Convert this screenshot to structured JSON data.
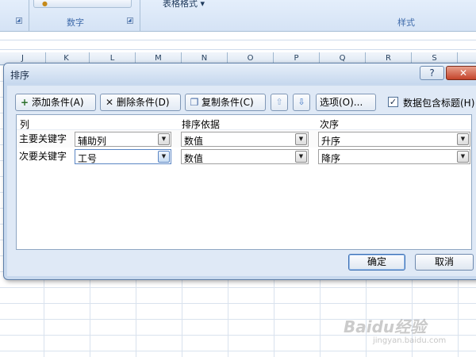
{
  "ribbon": {
    "number_group_label": "数字",
    "style_group_label": "样式",
    "table_format_label": "表格格式 ▾"
  },
  "columns": [
    "J",
    "K",
    "L",
    "M",
    "N",
    "O",
    "P",
    "Q",
    "R",
    "S"
  ],
  "dialog": {
    "title": "排序",
    "help_label": "?",
    "close_label": "✕",
    "toolbar": {
      "add_condition": "添加条件(A)",
      "delete_condition": "删除条件(D)",
      "copy_condition": "复制条件(C)",
      "move_up_glyph": "⇧",
      "move_down_glyph": "⇩",
      "options": "选项(O)...",
      "header_checkbox_checked": true,
      "header_checkbox_label": "数据包含标题(H)"
    },
    "grid_headers": {
      "column": "列",
      "sort_on": "排序依据",
      "order": "次序"
    },
    "rows": [
      {
        "label": "主要关键字",
        "column": "辅助列",
        "sort_on": "数值",
        "order": "升序"
      },
      {
        "label": "次要关键字",
        "column": "工号",
        "sort_on": "数值",
        "order": "降序"
      }
    ],
    "ok_label": "确定",
    "cancel_label": "取消"
  },
  "watermark": {
    "text": "Baidu经验",
    "sub": "jingyan.baidu.com"
  }
}
